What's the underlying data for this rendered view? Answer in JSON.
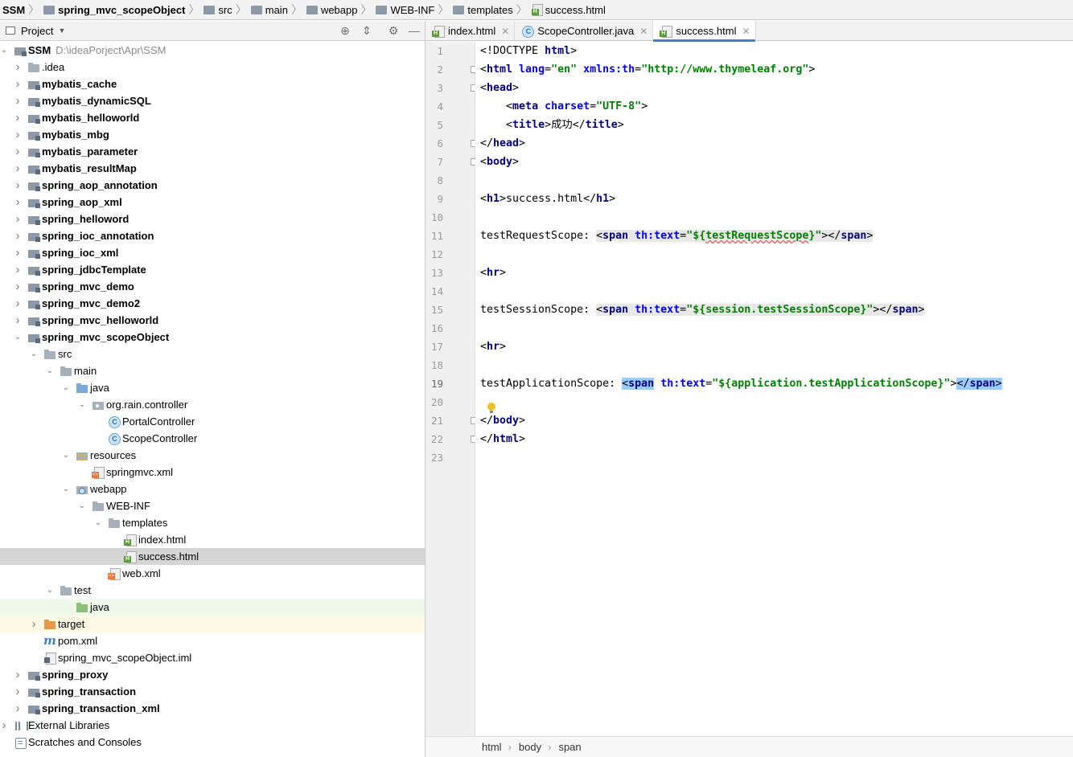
{
  "navbar": {
    "crumbs": [
      "SSM",
      "spring_mvc_scopeObject",
      "src",
      "main",
      "webapp",
      "WEB-INF",
      "templates",
      "success.html"
    ]
  },
  "project_pane": {
    "title": "Project",
    "icons": [
      "locate-icon",
      "collapse-icon",
      "gear-icon",
      "minimize-icon"
    ]
  },
  "tree": [
    {
      "label": "SSM",
      "extra": "D:\\ideaPorject\\Apr\\SSM",
      "icon": "module",
      "depth": 0,
      "expanded": true,
      "bold": true
    },
    {
      "label": ".idea",
      "icon": "folder",
      "depth": 1,
      "expanded": false
    },
    {
      "label": "mybatis_cache",
      "icon": "module",
      "depth": 1,
      "expanded": false,
      "bold": true
    },
    {
      "label": "mybatis_dynamicSQL",
      "icon": "module",
      "depth": 1,
      "expanded": false,
      "bold": true
    },
    {
      "label": "mybatis_helloworld",
      "icon": "module",
      "depth": 1,
      "expanded": false,
      "bold": true
    },
    {
      "label": "mybatis_mbg",
      "icon": "module",
      "depth": 1,
      "expanded": false,
      "bold": true
    },
    {
      "label": "mybatis_parameter",
      "icon": "module",
      "depth": 1,
      "expanded": false,
      "bold": true
    },
    {
      "label": "mybatis_resultMap",
      "icon": "module",
      "depth": 1,
      "expanded": false,
      "bold": true
    },
    {
      "label": "spring_aop_annotation",
      "icon": "module",
      "depth": 1,
      "expanded": false,
      "bold": true
    },
    {
      "label": "spring_aop_xml",
      "icon": "module",
      "depth": 1,
      "expanded": false,
      "bold": true
    },
    {
      "label": "spring_helloword",
      "icon": "module",
      "depth": 1,
      "expanded": false,
      "bold": true
    },
    {
      "label": "spring_ioc_annotation",
      "icon": "module",
      "depth": 1,
      "expanded": false,
      "bold": true
    },
    {
      "label": "spring_ioc_xml",
      "icon": "module",
      "depth": 1,
      "expanded": false,
      "bold": true
    },
    {
      "label": "spring_jdbcTemplate",
      "icon": "module",
      "depth": 1,
      "expanded": false,
      "bold": true
    },
    {
      "label": "spring_mvc_demo",
      "icon": "module",
      "depth": 1,
      "expanded": false,
      "bold": true
    },
    {
      "label": "spring_mvc_demo2",
      "icon": "module",
      "depth": 1,
      "expanded": false,
      "bold": true
    },
    {
      "label": "spring_mvc_helloworld",
      "icon": "module",
      "depth": 1,
      "expanded": false,
      "bold": true
    },
    {
      "label": "spring_mvc_scopeObject",
      "icon": "module",
      "depth": 1,
      "expanded": true,
      "bold": true
    },
    {
      "label": "src",
      "icon": "folder",
      "depth": 2,
      "expanded": true
    },
    {
      "label": "main",
      "icon": "folder",
      "depth": 3,
      "expanded": true
    },
    {
      "label": "java",
      "icon": "src",
      "depth": 4,
      "expanded": true
    },
    {
      "label": "org.rain.controller",
      "icon": "pkg",
      "depth": 5,
      "expanded": true
    },
    {
      "label": "PortalController",
      "icon": "cls",
      "depth": 6
    },
    {
      "label": "ScopeController",
      "icon": "cls",
      "depth": 6
    },
    {
      "label": "resources",
      "icon": "res",
      "depth": 4,
      "expanded": true
    },
    {
      "label": "springmvc.xml",
      "icon": "xml",
      "depth": 5
    },
    {
      "label": "webapp",
      "icon": "web",
      "depth": 4,
      "expanded": true
    },
    {
      "label": "WEB-INF",
      "icon": "folder",
      "depth": 5,
      "expanded": true
    },
    {
      "label": "templates",
      "icon": "folder",
      "depth": 6,
      "expanded": true
    },
    {
      "label": "index.html",
      "icon": "html",
      "depth": 7
    },
    {
      "label": "success.html",
      "icon": "html",
      "depth": 7,
      "selected": true
    },
    {
      "label": "web.xml",
      "icon": "xml",
      "depth": 6
    },
    {
      "label": "test",
      "icon": "folder",
      "depth": 3,
      "expanded": true
    },
    {
      "label": "java",
      "icon": "testsrc",
      "depth": 4,
      "test": true
    },
    {
      "label": "target",
      "icon": "target",
      "depth": 2,
      "expanded": false,
      "excluded": true
    },
    {
      "label": "pom.xml",
      "icon": "maven",
      "depth": 2
    },
    {
      "label": "spring_mvc_scopeObject.iml",
      "icon": "iml",
      "depth": 2
    },
    {
      "label": "spring_proxy",
      "icon": "module",
      "depth": 1,
      "expanded": false,
      "bold": true
    },
    {
      "label": "spring_transaction",
      "icon": "module",
      "depth": 1,
      "expanded": false,
      "bold": true
    },
    {
      "label": "spring_transaction_xml",
      "icon": "module",
      "depth": 1,
      "expanded": false,
      "bold": true
    },
    {
      "label": "External Libraries",
      "icon": "lib",
      "depth": 0,
      "expanded": false
    },
    {
      "label": "Scratches and Consoles",
      "icon": "scratch",
      "depth": 0
    }
  ],
  "tabs": [
    {
      "label": "index.html",
      "icon": "html",
      "active": false
    },
    {
      "label": "ScopeController.java",
      "icon": "cls",
      "active": false
    },
    {
      "label": "success.html",
      "icon": "html",
      "active": true
    }
  ],
  "editor": {
    "current_line": 19,
    "lines": [
      [
        [
          "punct",
          "<!DOCTYPE "
        ],
        [
          "tag",
          "html"
        ],
        [
          "punct",
          ">"
        ]
      ],
      [
        [
          "punct",
          "<"
        ],
        [
          "tag",
          "html "
        ],
        [
          "attr",
          "lang"
        ],
        [
          "punct",
          "="
        ],
        [
          "val",
          "\"en\" "
        ],
        [
          "attr",
          "xmlns:th"
        ],
        [
          "punct",
          "="
        ],
        [
          "val",
          "\"http://www.thymeleaf.org\""
        ],
        [
          "punct",
          ">"
        ]
      ],
      [
        [
          "punct",
          "<"
        ],
        [
          "tag",
          "head"
        ],
        [
          "punct",
          ">"
        ]
      ],
      [
        [
          "txt",
          "    "
        ],
        [
          "punct",
          "<"
        ],
        [
          "tag",
          "meta "
        ],
        [
          "attr",
          "charset"
        ],
        [
          "punct",
          "="
        ],
        [
          "val",
          "\"UTF-8\""
        ],
        [
          "punct",
          ">"
        ]
      ],
      [
        [
          "txt",
          "    "
        ],
        [
          "punct",
          "<"
        ],
        [
          "tag",
          "title"
        ],
        [
          "punct",
          ">"
        ],
        [
          "txt",
          "成功"
        ],
        [
          "punct",
          "</"
        ],
        [
          "tag",
          "title"
        ],
        [
          "punct",
          ">"
        ]
      ],
      [
        [
          "punct",
          "</"
        ],
        [
          "tag",
          "head"
        ],
        [
          "punct",
          ">"
        ]
      ],
      [
        [
          "punct",
          "<"
        ],
        [
          "tag",
          "body"
        ],
        [
          "punct",
          ">"
        ]
      ],
      [],
      [
        [
          "punct",
          "<"
        ],
        [
          "tag",
          "h1"
        ],
        [
          "punct",
          ">"
        ],
        [
          "txt",
          "success.html"
        ],
        [
          "punct",
          "</"
        ],
        [
          "tag",
          "h1"
        ],
        [
          "punct",
          ">"
        ]
      ],
      [],
      [
        [
          "txt",
          "testRequestScope: "
        ],
        [
          "hl",
          "<"
        ],
        [
          "hltag",
          "span "
        ],
        [
          "hlattr",
          "th:text"
        ],
        [
          "hl",
          "="
        ],
        [
          "hlval",
          "\"${"
        ],
        [
          "hlsq",
          "testRequestScope"
        ],
        [
          "hlval",
          "}\""
        ],
        [
          "hl",
          ">"
        ],
        [
          "hl",
          "</"
        ],
        [
          "hltag",
          "span"
        ],
        [
          "hl",
          ">"
        ]
      ],
      [],
      [
        [
          "punct",
          "<"
        ],
        [
          "tag",
          "hr"
        ],
        [
          "punct",
          ">"
        ]
      ],
      [],
      [
        [
          "txt",
          "testSessionScope: "
        ],
        [
          "hl",
          "<"
        ],
        [
          "hltag",
          "span "
        ],
        [
          "hlattr",
          "th:text"
        ],
        [
          "hl",
          "="
        ],
        [
          "hlval",
          "\"${"
        ],
        [
          "hlval",
          "session.testSessionScope"
        ],
        [
          "hlval",
          "}\""
        ],
        [
          "hl",
          ">"
        ],
        [
          "hl",
          "</"
        ],
        [
          "hltag",
          "span"
        ],
        [
          "hl",
          ">"
        ]
      ],
      [],
      [
        [
          "punct",
          "<"
        ],
        [
          "tag",
          "hr"
        ],
        [
          "punct",
          ">"
        ]
      ],
      [],
      [
        [
          "txt",
          "testApplicationScope: "
        ],
        [
          "mt",
          "<"
        ],
        [
          "mttag",
          "span"
        ],
        [
          "txt",
          " "
        ],
        [
          "attr",
          "th:text"
        ],
        [
          "punct",
          "="
        ],
        [
          "val",
          "\"${application.testApplicationScope}\""
        ],
        [
          "punct",
          ">"
        ],
        [
          "mt",
          "</"
        ],
        [
          "mttag",
          "span"
        ],
        [
          "mt",
          ">"
        ]
      ],
      [],
      [
        [
          "punct",
          "</"
        ],
        [
          "tag",
          "body"
        ],
        [
          "punct",
          ">"
        ]
      ],
      [
        [
          "punct",
          "</"
        ],
        [
          "tag",
          "html"
        ],
        [
          "punct",
          ">"
        ]
      ],
      []
    ]
  },
  "bottom_breadcrumb": [
    "html",
    "body",
    "span"
  ]
}
